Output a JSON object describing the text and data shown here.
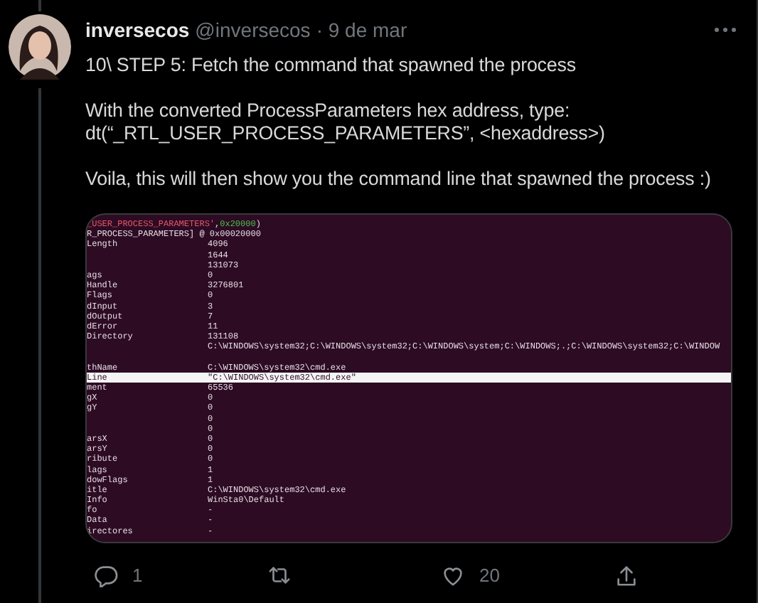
{
  "tweet": {
    "author": "inversecos",
    "handle": "@inversecos",
    "date": "· 9 de mar",
    "paragraphs": [
      "10\\ STEP 5: Fetch the command that spawned the process",
      "With the converted ProcessParameters hex address, type:\ndt(“_RTL_USER_PROCESS_PARAMETERS”, <hexaddress>)",
      "Voila, this will then show you the command line that spawned the process :)"
    ]
  },
  "terminal": {
    "header": [
      {
        "text": "_USER_PROCESS_PARAMETERS'",
        "color": "#e8576a"
      },
      {
        "text": ", "
      },
      {
        "text": "0x20000",
        "color": "#4fc04a"
      },
      {
        "text": ")"
      }
    ],
    "rows": [
      {
        "kind": "line",
        "label": "R_PROCESS_PARAMETERS] @ 0x00020000",
        "selected": false
      },
      {
        "kind": "line",
        "label": "Length",
        "value": "4096",
        "selected": false
      },
      {
        "kind": "line",
        "value": "1644",
        "selected": false
      },
      {
        "kind": "line",
        "value": "131073",
        "selected": false
      },
      {
        "kind": "line",
        "label": "ags",
        "value": "0",
        "selected": false
      },
      {
        "kind": "line",
        "label": "Handle",
        "value": "3276801",
        "selected": false
      },
      {
        "kind": "line",
        "label": "Flags",
        "value": "0",
        "selected": false
      },
      {
        "kind": "line",
        "label": "dInput",
        "value": "3",
        "selected": false
      },
      {
        "kind": "line",
        "label": "dOutput",
        "value": "7",
        "selected": false
      },
      {
        "kind": "line",
        "label": "dError",
        "value": "11",
        "selected": false
      },
      {
        "kind": "line",
        "label": "Directory",
        "value": "131108",
        "selected": false
      },
      {
        "kind": "line",
        "value": "C:\\WINDOWS\\system32;C:\\WINDOWS\\system32;C:\\WINDOWS\\system;C:\\WINDOWS;.;C:\\WINDOWS\\system32;C:\\WINDOW",
        "selected": false
      },
      {
        "kind": "blank",
        "selected": false
      },
      {
        "kind": "line",
        "label": "thName",
        "value": "C:\\WINDOWS\\system32\\cmd.exe",
        "selected": false
      },
      {
        "kind": "line",
        "label": "Line",
        "value": "\"C:\\WINDOWS\\system32\\cmd.exe\"",
        "selected": true
      },
      {
        "kind": "line",
        "label": "ment",
        "value": "65536",
        "selected": false
      },
      {
        "kind": "line",
        "label": "gX",
        "value": "0",
        "selected": false
      },
      {
        "kind": "line",
        "label": "gY",
        "value": "0",
        "selected": false
      },
      {
        "kind": "line",
        "value": "0",
        "selected": false
      },
      {
        "kind": "line",
        "value": "0",
        "selected": false
      },
      {
        "kind": "line",
        "label": "arsX",
        "value": "0",
        "selected": false
      },
      {
        "kind": "line",
        "label": "arsY",
        "value": "0",
        "selected": false
      },
      {
        "kind": "line",
        "label": "ribute",
        "value": "0",
        "selected": false
      },
      {
        "kind": "line",
        "label": "lags",
        "value": "1",
        "selected": false
      },
      {
        "kind": "line",
        "label": "dowFlags",
        "value": "1",
        "selected": false
      },
      {
        "kind": "line",
        "label": "itle",
        "value": "C:\\WINDOWS\\system32\\cmd.exe",
        "selected": false
      },
      {
        "kind": "line",
        "label": "Info",
        "value": "WinSta0\\Default",
        "selected": false
      },
      {
        "kind": "line",
        "label": "fo",
        "value": "-",
        "selected": false
      },
      {
        "kind": "line",
        "label": "Data",
        "value": "-",
        "selected": false
      },
      {
        "kind": "line",
        "label": "irectores",
        "value": "-",
        "selected": false
      }
    ]
  },
  "actions": [
    {
      "kind": "reply",
      "count": "1"
    },
    {
      "kind": "retweet"
    },
    {
      "kind": "like",
      "count": "20"
    },
    {
      "kind": "share"
    }
  ]
}
